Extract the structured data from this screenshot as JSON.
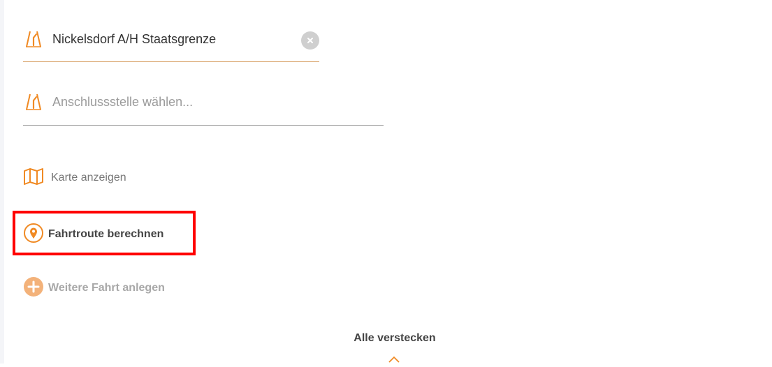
{
  "form": {
    "from_value": "Nickelsdorf A/H Staatsgrenze",
    "to_placeholder": "Anschlussstelle wählen...",
    "from_icon": "highway-exit-icon",
    "to_icon": "highway-exit-icon",
    "clear_icon": "clear-icon"
  },
  "actions": {
    "map_label": "Karte anzeigen",
    "map_icon": "map-icon",
    "route_label": "Fahrtroute berechnen",
    "route_icon": "location-pin-icon",
    "add_label": "Weitere Fahrt anlegen",
    "add_icon": "plus-circle-icon"
  },
  "footer": {
    "hide_all_label": "Alle verstecken",
    "chevron_icon": "chevron-up-icon"
  },
  "colors": {
    "accent": "#F08A24",
    "accent_muted": "#F3B27A",
    "highlight": "#FF0000"
  }
}
